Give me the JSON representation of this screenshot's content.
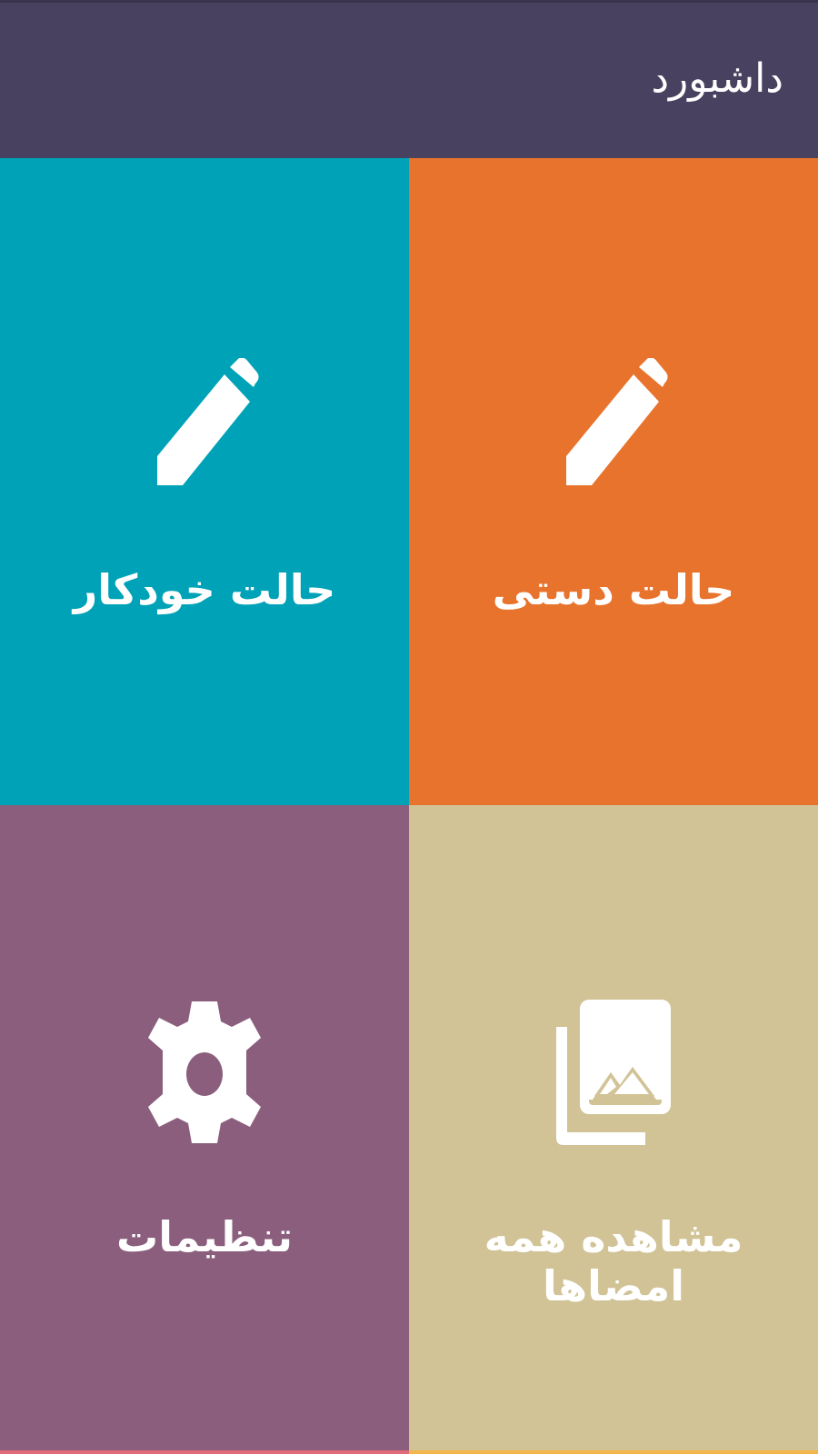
{
  "app": {
    "title": "داشبورد"
  },
  "colors": {
    "topbar": "#48415f",
    "tile_manual": "#e8732c",
    "tile_auto": "#00a2b7",
    "tile_signatures": "#d1c396",
    "tile_settings": "#8a5e7c",
    "strip_left": "#e0697a",
    "strip_right": "#f2b64a"
  },
  "tiles": [
    {
      "id": "manual",
      "label": "حالت دستی",
      "icon": "pencil-icon"
    },
    {
      "id": "auto",
      "label": "حالت خودکار",
      "icon": "pencil-icon"
    },
    {
      "id": "signatures",
      "label": "مشاهده همه امضاها",
      "icon": "gallery-icon"
    },
    {
      "id": "settings",
      "label": "تنظیمات",
      "icon": "gear-icon"
    }
  ]
}
